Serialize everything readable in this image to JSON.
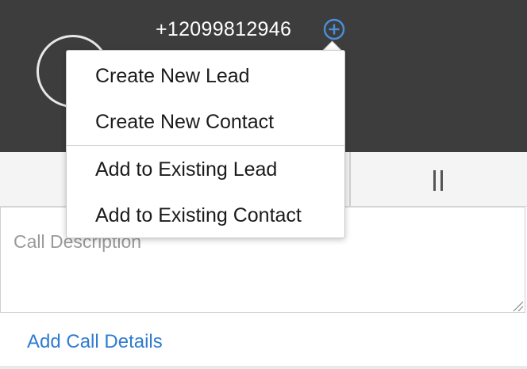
{
  "caller": {
    "phone_number": "+12099812946"
  },
  "actions": {
    "add_icon": "plus-circle-icon",
    "pause_icon": "pause-icon",
    "add_call_details_label": "Add Call Details"
  },
  "call_description": {
    "placeholder": "Call Description",
    "value": ""
  },
  "dropdown_menu": {
    "items": [
      {
        "label": "Create New Lead"
      },
      {
        "label": "Create New Contact"
      },
      {
        "label": "Add to Existing Lead"
      },
      {
        "label": "Add to Existing Contact"
      }
    ]
  },
  "colors": {
    "header_bg": "#3d3d3d",
    "accent_blue": "#2f7bd0",
    "plus_icon_blue": "#4a90d9"
  }
}
